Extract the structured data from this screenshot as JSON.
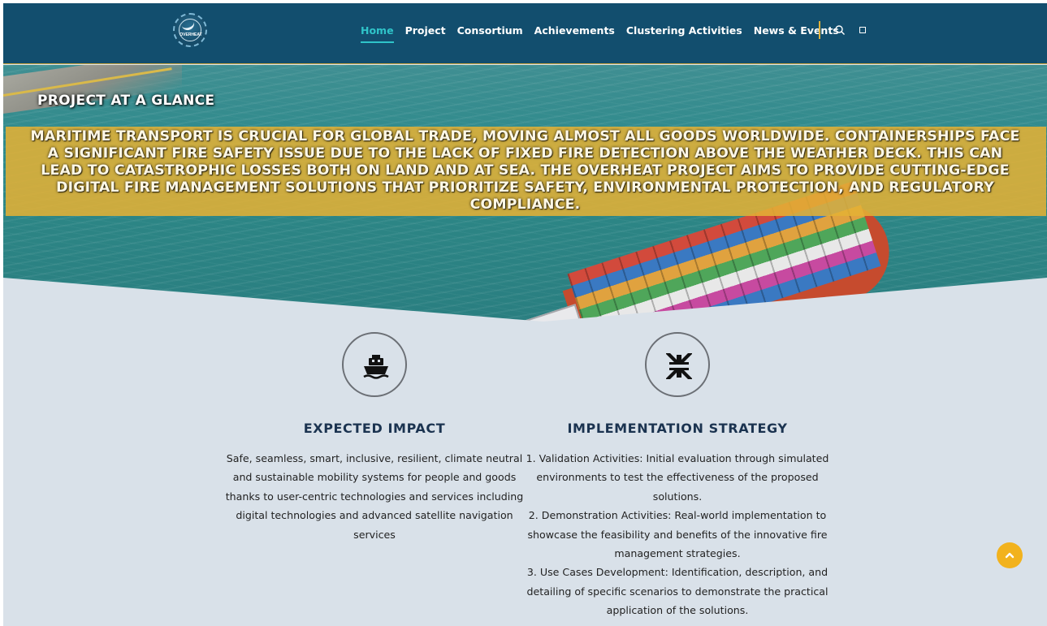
{
  "nav": {
    "logo_text": "OVERHEAT",
    "items": [
      {
        "label": "Home",
        "active": true
      },
      {
        "label": "Project"
      },
      {
        "label": "Consortium"
      },
      {
        "label": "Achievements"
      },
      {
        "label": "Clustering Activities"
      },
      {
        "label": "News & Events"
      }
    ],
    "search_icon": "search-icon",
    "square_icon": "square-icon"
  },
  "hero": {
    "heading": "PROJECT AT A GLANCE",
    "lines": [
      "MARITIME TRANSPORT IS CRUCIAL FOR GLOBAL TRADE, MOVING ALMOST ALL GOODS WORLDWIDE. CONTAINERSHIPS FACE",
      "A SIGNIFICANT FIRE SAFETY ISSUE DUE TO THE LACK OF FIXED FIRE DETECTION ABOVE THE WEATHER DECK. THIS CAN",
      "LEAD TO CATASTROPHIC LOSSES BOTH ON LAND AND AT SEA. THE OVERHEAT PROJECT AIMS TO PROVIDE CUTTING-EDGE",
      "DIGITAL FIRE MANAGEMENT SOLUTIONS THAT PRIORITIZE SAFETY, ENVIRONMENTAL PROTECTION, AND REGULATORY",
      "COMPLIANCE."
    ]
  },
  "features": [
    {
      "icon": "ship-icon",
      "title": "EXPECTED IMPACT",
      "lines": [
        "Safe, seamless, smart, inclusive, resilient, climate neutral",
        "and sustainable mobility systems for people and goods",
        "thanks to user-centric technologies and services including",
        "digital technologies and advanced satellite navigation",
        "services"
      ]
    },
    {
      "icon": "compress-arrows-icon",
      "title": "IMPLEMENTATION STRATEGY",
      "lines": [
        "1. Validation Activities: Initial evaluation through simulated",
        "environments to test the effectiveness of the proposed",
        "solutions.",
        "2. Demonstration Activities: Real-world implementation to",
        "showcase the feasibility and benefits of the innovative fire",
        "management strategies.",
        "3. Use Cases Development: Identification, description, and",
        "detailing of specific scenarios to demonstrate the practical",
        "application of the solutions."
      ]
    }
  ],
  "colors": {
    "nav_bg": "#124e6e",
    "accent_teal": "#2fc4c9",
    "banner_gold": "#e2b136",
    "page_bg": "#d9e1e9",
    "scroll_button": "#f2b21d"
  },
  "scroll_top_icon": "chevron-up-icon"
}
